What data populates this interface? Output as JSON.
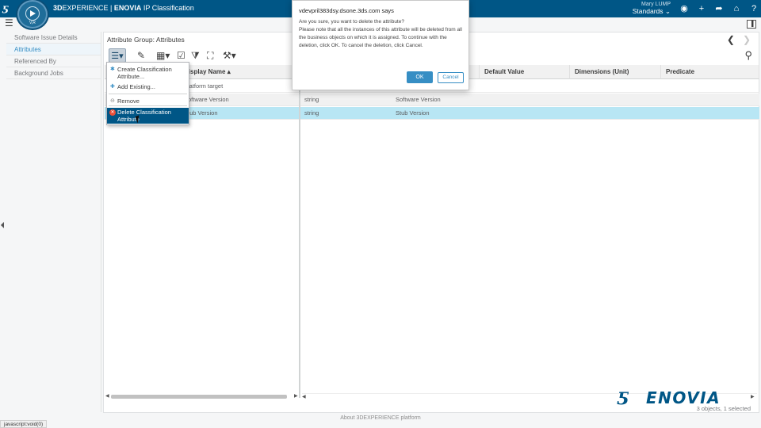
{
  "topbar": {
    "brand_prefix": "3D",
    "brand_main": "EXPERIENCE",
    "brand_sep": " | ",
    "app_name": "ENOVIA",
    "app_module": "IP Classification",
    "compass_version": "V,R",
    "user_name": "Mary LUMP",
    "collab_space": "Standards ⌄",
    "icons": [
      "user-icon",
      "add-icon",
      "share-icon",
      "home-icon",
      "help-icon"
    ]
  },
  "leftnav": {
    "items": [
      "Software Issue Details",
      "Attributes",
      "Referenced By",
      "Background Jobs"
    ],
    "active_index": 1
  },
  "main": {
    "title": "Attribute Group: Attributes",
    "prev_arrow": "❮",
    "next_arrow": "❯"
  },
  "table": {
    "headers": [
      "Display Name ▴",
      "",
      "",
      "Default Value",
      "Dimensions (Unit)",
      "Predicate"
    ],
    "rows": [
      {
        "name": "Platform target",
        "type": "",
        "label": ""
      },
      {
        "name": "Software Version",
        "type": "string",
        "label": "Software Version"
      },
      {
        "name": "Stub Version",
        "type": "string",
        "label": "Stub Version"
      }
    ]
  },
  "menu": {
    "create": "Create Classification Attribute...",
    "add_existing": "Add Existing...",
    "remove": "Remove",
    "delete": "Delete Classification Attribute"
  },
  "dialog": {
    "title": "vdevpril383dsy.dsone.3ds.com says",
    "message_line1": "Are you sure, you want to delete the attribute?",
    "message_line2": "Please note that all the instances of this attribute will be deleted from all the business objects on which it is assigned. To continue with the deletion, click OK. To cancel the deletion, click Cancel.",
    "ok_label": "OK",
    "cancel_label": "Cancel"
  },
  "status": {
    "count": "3 objects, 1 selected"
  },
  "brand": {
    "logo_text": "ENOVIA",
    "colors": {
      "primary": "#005686",
      "accent": "#368ec4",
      "danger": "#ea4f37"
    }
  },
  "footer": {
    "about": "About 3DEXPERIENCE platform",
    "url_status": "javascript:void(0)"
  }
}
